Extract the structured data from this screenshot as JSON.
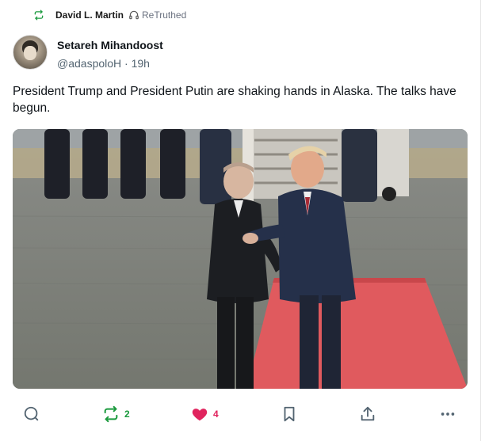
{
  "retruth": {
    "user": "David L. Martin",
    "label": "ReTruthed"
  },
  "post": {
    "author_name": "Setareh Mihandoost",
    "handle": "@adaspoloH",
    "separator": "·",
    "time": "19h",
    "text": "President Trump and President Putin are shaking hands in Alaska. The talks have begun."
  },
  "actions": {
    "retruth_count": "2",
    "like_count": "4"
  },
  "icons": {
    "retruth": "retruth-icon",
    "headphones": "headphones-icon",
    "reply": "reply-icon",
    "like": "heart-icon",
    "bookmark": "bookmark-icon",
    "share": "share-icon",
    "more": "more-icon"
  },
  "colors": {
    "green": "#1b9a3e",
    "pink": "#e0245e",
    "carpet": "#e05a5e"
  }
}
